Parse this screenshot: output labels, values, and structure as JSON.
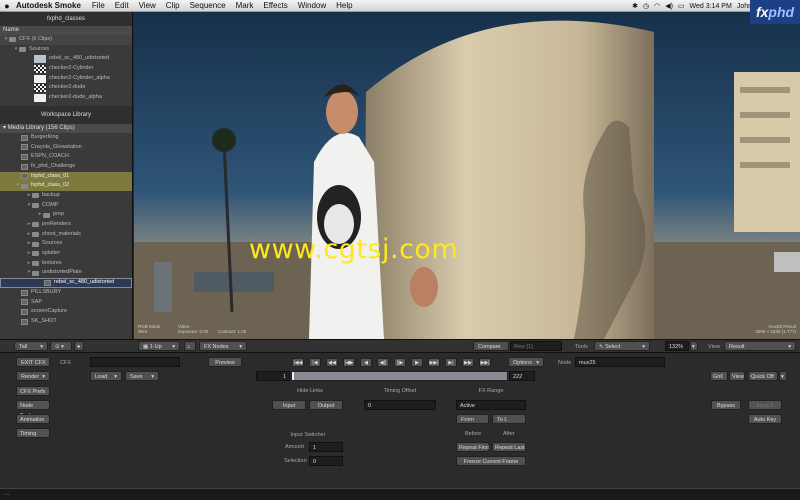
{
  "menubar": {
    "app_name": "Autodesk Smoke",
    "items": [
      "File",
      "Edit",
      "View",
      "Clip",
      "Sequence",
      "Mark",
      "Effects",
      "Window",
      "Help"
    ],
    "clock": "Wed 3:14 PM",
    "user": "John"
  },
  "brand": {
    "prefix": "fx",
    "suffix": "phd"
  },
  "left_panel": {
    "title": "fxphd_classes",
    "name_header": "Name",
    "cfx_header": "CFX (6 Clips)",
    "sources_label": "Sources",
    "sources": [
      {
        "label": "rebel_sc_480_udistorted",
        "thumb": "light"
      },
      {
        "label": "checker2-Cylinder",
        "thumb": "checker"
      },
      {
        "label": "checker2-Cylinder_alpha",
        "thumb": "white"
      },
      {
        "label": "checker2-dude",
        "thumb": "checker"
      },
      {
        "label": "checker2-dude_alpha",
        "thumb": "white"
      }
    ],
    "workspace_title": "Workspace Library",
    "media_header": "Media Library (156 Clips)",
    "media": [
      {
        "label": "BurgerKing",
        "indent": 1,
        "icon": "clip"
      },
      {
        "label": "Crayola_Glowstation",
        "indent": 1,
        "icon": "clip"
      },
      {
        "label": "ESPN_COACH",
        "indent": 1,
        "icon": "clip"
      },
      {
        "label": "fx_phd_Challenge",
        "indent": 1,
        "icon": "clip"
      },
      {
        "label": "fxphd_class_01",
        "indent": 1,
        "icon": "clip",
        "state": "hl"
      },
      {
        "label": "fxphd_class_02",
        "indent": 1,
        "icon": "folder",
        "toggle": "▾",
        "state": "hl"
      },
      {
        "label": "backup",
        "indent": 2,
        "icon": "folder",
        "toggle": "▸"
      },
      {
        "label": "COMP",
        "indent": 2,
        "icon": "folder",
        "toggle": "▾"
      },
      {
        "label": "prep",
        "indent": 3,
        "icon": "folder",
        "toggle": "▸"
      },
      {
        "label": "preRenders",
        "indent": 2,
        "icon": "folder",
        "toggle": "▸"
      },
      {
        "label": "shoot_materials",
        "indent": 2,
        "icon": "folder",
        "toggle": "▸"
      },
      {
        "label": "Sources",
        "indent": 2,
        "icon": "folder",
        "toggle": "▸"
      },
      {
        "label": "splatter",
        "indent": 2,
        "icon": "folder",
        "toggle": "▸"
      },
      {
        "label": "textures",
        "indent": 2,
        "icon": "folder",
        "toggle": "▸"
      },
      {
        "label": "undistortedPlate",
        "indent": 2,
        "icon": "folder",
        "toggle": "▾"
      },
      {
        "label": "rebel_sc_480_udistorted",
        "indent": 3,
        "icon": "clip",
        "state": "sel"
      },
      {
        "label": "PILLSBURY",
        "indent": 1,
        "icon": "clip"
      },
      {
        "label": "SAP",
        "indent": 1,
        "icon": "clip"
      },
      {
        "label": "screenCapture",
        "indent": 1,
        "icon": "clip"
      },
      {
        "label": "SK_SHOT",
        "indent": 1,
        "icon": "clip"
      }
    ]
  },
  "viewer": {
    "watermark": "www.cgtsj.com",
    "info_left": [
      "RGB Mode",
      "Wire"
    ],
    "info_video": [
      "Video",
      "Exposure: 0.00"
    ],
    "info_contrast": "Contrast: 1.00",
    "info_right": [
      "mux25 Result",
      "2008 × 1536 (1.777)"
    ]
  },
  "midbar": {
    "tall": "Tall",
    "oneup": "1-Up",
    "fx_nodes": "FX Nodes",
    "compare": "Compare",
    "compare_value": "Rew [1]",
    "tools": "Tools",
    "tools_value": "Select",
    "zoom": "132%",
    "view_label": "View",
    "view_value": "Result"
  },
  "cfx": {
    "exit": "EXIT CFX",
    "cfx_label": "CFX",
    "preview": "Preview",
    "node_label": "Node",
    "node_value": "mux25",
    "options": "Options",
    "render": "Render",
    "load": "Load",
    "save": "Save",
    "frame_start": "1",
    "frame_end": "222",
    "grid": "Grill",
    "view": "View",
    "quick_off": "Quick Off",
    "side_buttons": [
      "CFX Prefs",
      "Node Prefs",
      "Animation",
      "Timing"
    ],
    "hide_links": "Hide Links",
    "input_btn": "Input",
    "output_btn": "Output",
    "timing_offset_label": "Timing Offset",
    "timing_offset": "0",
    "fx_range_label": "FX Range",
    "active": "Active",
    "from": "From",
    "to": "To L",
    "input_switcher_label": "Input Switcher",
    "amount_label": "Amount",
    "amount": "1",
    "selection_label": "Selection",
    "selection": "0",
    "before": "Before",
    "after": "After",
    "repeat_first": "Repeat First",
    "repeat_last": "Repeat Last",
    "freeze": "Freeze Current Frame",
    "bypass": "Bypass",
    "input_b": "Input 2",
    "auto_key": "Auto Key",
    "transport": [
      "|◀◀",
      "|◀",
      "◀◀",
      "|◀▶",
      "◀",
      "◀||",
      "||▶",
      "▶",
      "▶▶|",
      "▶|",
      "▶▶",
      "▶▶|"
    ]
  },
  "statusbar": {
    "text": "..."
  }
}
